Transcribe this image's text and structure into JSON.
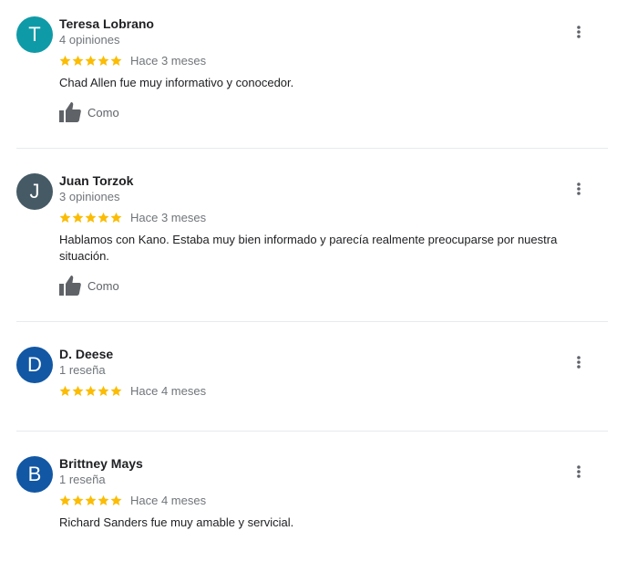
{
  "colors": {
    "star": "#fbbc04",
    "thumb": "#5f6368"
  },
  "icons": {
    "star": "star-icon",
    "like": "thumbs-up-icon",
    "menu": "more-vert-icon"
  },
  "reviews": [
    {
      "initial": "T",
      "avatar_color": "#0f9aa7",
      "name": "Teresa Lobrano",
      "count": "4 opiniones",
      "rating": 5,
      "time": "Hace 3 meses",
      "text": "Chad Allen fue muy informativo y conocedor.",
      "like_label": "Como"
    },
    {
      "initial": "J",
      "avatar_color": "#455a64",
      "name": "Juan Torzok",
      "count": "3 opiniones",
      "rating": 5,
      "time": "Hace 3 meses",
      "text": "Hablamos con Kano. Estaba muy bien informado y parecía realmente preocuparse por nuestra situación.",
      "like_label": "Como"
    },
    {
      "initial": "D",
      "avatar_color": "#1157a4",
      "name": "D. Deese",
      "count": "1 reseña",
      "rating": 5,
      "time": "Hace 4 meses"
    },
    {
      "initial": "B",
      "avatar_color": "#1157a4",
      "name": "Brittney Mays",
      "count": "1 reseña",
      "rating": 5,
      "time": "Hace 4 meses",
      "text": "Richard Sanders fue muy amable y servicial."
    }
  ]
}
